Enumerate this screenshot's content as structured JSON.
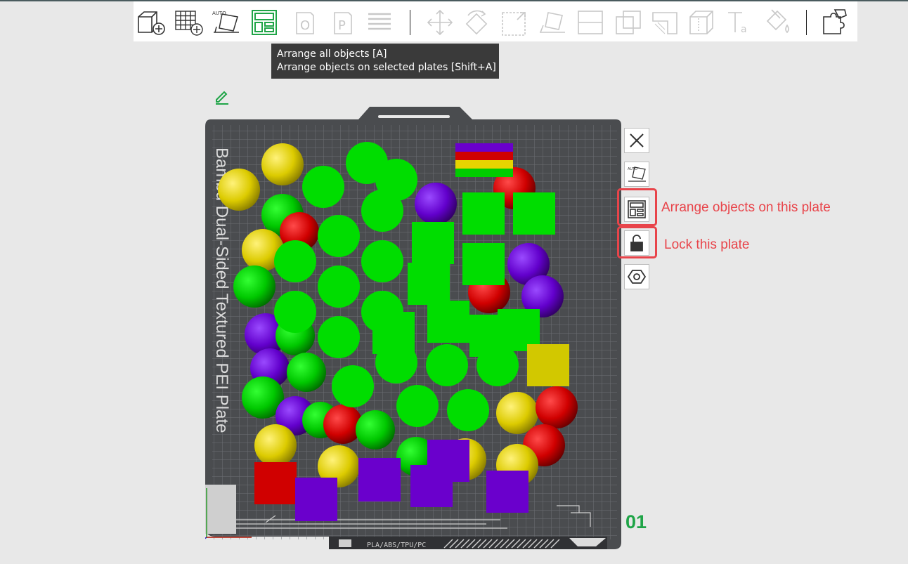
{
  "toolbar": {
    "groups": [
      [
        "add-cube-icon",
        "add-plate-icon",
        "auto-orient-icon",
        "arrange-icon"
      ],
      [
        "plate-O-icon",
        "plate-P-icon",
        "layers-icon"
      ],
      [
        "move-icon",
        "rotate-icon",
        "scale-icon",
        "lay-on-face-icon",
        "cut-icon",
        "boolean-icon",
        "support-paint-icon",
        "seam-paint-icon",
        "text-icon",
        "color-paint-icon"
      ],
      [
        "assembly-icon"
      ]
    ]
  },
  "tooltip": {
    "line1": "Arrange all objects [A]",
    "line2": "Arrange objects on selected plates [Shift+A]"
  },
  "plate": {
    "name": "Bambu Dual-Sided Textured PEI Plate",
    "filament_label": "PLA/ABS/TPU/PC",
    "number": "01"
  },
  "plate_buttons": [
    "close-icon",
    "auto-orient-plate-icon",
    "arrange-plate-icon",
    "lock-icon",
    "settings-icon"
  ],
  "callouts": {
    "arrange": "Arrange objects on this plate",
    "lock": "Lock this plate"
  },
  "colors": {
    "accent_red": "#e8444a",
    "plate_number_green": "#1fa447",
    "bed": "#494b4e",
    "green": "#00dd00",
    "yellow": "#e6d400",
    "red": "#d00000",
    "purple": "#6a00cc"
  }
}
